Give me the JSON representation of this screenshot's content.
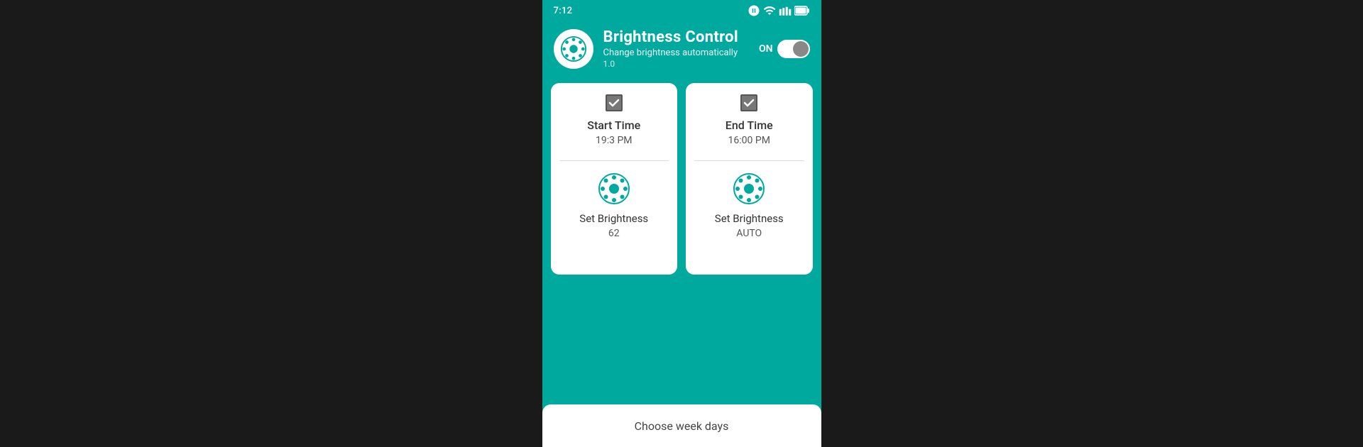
{
  "statusBar": {
    "time": "7:12",
    "icons": [
      "data-saver",
      "wifi",
      "signal",
      "battery"
    ]
  },
  "header": {
    "title": "Brightness Control",
    "subtitle": "Change brightness automatically",
    "version": "1.0",
    "toggleLabel": "ON",
    "toggleState": true
  },
  "cards": [
    {
      "id": "start",
      "checkboxChecked": true,
      "label": "Start Time",
      "time": "19:3 PM",
      "brightnessLabel": "Set Brightness",
      "brightnessValue": "62"
    },
    {
      "id": "end",
      "checkboxChecked": true,
      "label": "End Time",
      "time": "16:00 PM",
      "brightnessLabel": "Set Brightness",
      "brightnessValue": "AUTO"
    }
  ],
  "bottomBar": {
    "label": "Choose week days"
  },
  "colors": {
    "teal": "#00a99d",
    "white": "#ffffff",
    "darkGray": "#555555"
  }
}
